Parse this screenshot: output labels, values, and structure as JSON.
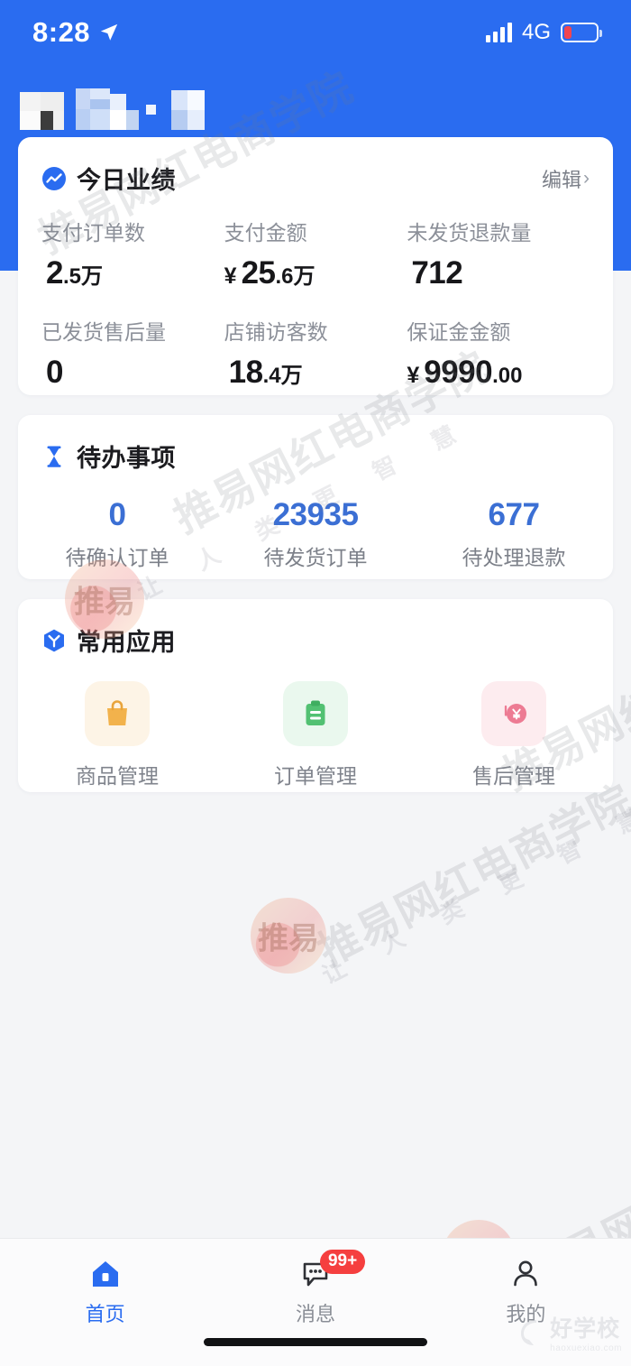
{
  "status_bar": {
    "time": "8:28",
    "location_icon": "location-arrow-icon",
    "signal_icon": "signal-bars-icon",
    "network": "4G",
    "battery_icon": "battery-low-icon"
  },
  "header": {
    "store_name_redacted": "",
    "background_color": "#2a6cf0"
  },
  "performance": {
    "icon": "trend-chart-icon",
    "title": "今日业绩",
    "edit_label": "编辑",
    "edit_chevron": "›",
    "metrics": [
      {
        "label": "支付订单数",
        "currency": "",
        "main": "2",
        "sub": ".5万"
      },
      {
        "label": "支付金额",
        "currency": "¥",
        "main": "25",
        "sub": ".6万"
      },
      {
        "label": "未发货退款量",
        "currency": "",
        "main": "712",
        "sub": ""
      },
      {
        "label": "已发货售后量",
        "currency": "",
        "main": "0",
        "sub": ""
      },
      {
        "label": "店铺访客数",
        "currency": "",
        "main": "18",
        "sub": ".4万"
      },
      {
        "label": "保证金金额",
        "currency": "¥",
        "main": "9990",
        "sub": ".00"
      }
    ]
  },
  "todo": {
    "icon": "hourglass-icon",
    "title": "待办事项",
    "accent_color": "#3b6fd4",
    "items": [
      {
        "value": "0",
        "label": "待确认订单"
      },
      {
        "value": "23935",
        "label": "待发货订单"
      },
      {
        "value": "677",
        "label": "待处理退款"
      }
    ]
  },
  "apps": {
    "icon": "cube-badge-icon",
    "title": "常用应用",
    "items": [
      {
        "name": "商品管理",
        "icon": "shopping-bag-icon",
        "tile_color": "#fdf4e6",
        "icon_color": "#f2b24c"
      },
      {
        "name": "订单管理",
        "icon": "clipboard-icon",
        "tile_color": "#eaf8ee",
        "icon_color": "#52c172"
      },
      {
        "name": "售后管理",
        "icon": "refund-yuan-icon",
        "tile_color": "#fdecef",
        "icon_color": "#ed7b93"
      }
    ]
  },
  "tabbar": {
    "active_color": "#2a6cf0",
    "items": [
      {
        "label": "首页",
        "icon": "home-icon",
        "active": true,
        "badge": ""
      },
      {
        "label": "消息",
        "icon": "message-icon",
        "active": false,
        "badge": "99+"
      },
      {
        "label": "我的",
        "icon": "person-icon",
        "active": false,
        "badge": ""
      }
    ]
  },
  "watermarks": {
    "main_text": "推易网红电商学院",
    "sub_text": "让 人 类 更 智 慧",
    "logo_text": "推易",
    "corner_brand": "好学校",
    "corner_brand_sub": "haoxuexiao.com"
  }
}
